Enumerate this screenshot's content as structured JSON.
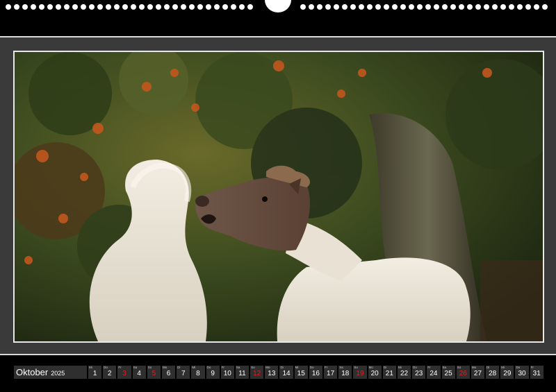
{
  "photo": {
    "subject": "two-ponies-photo"
  },
  "calendar": {
    "month": "Oktober",
    "year": "2025",
    "days": [
      {
        "wd": "Mi",
        "n": "1",
        "red": false
      },
      {
        "wd": "Do",
        "n": "2",
        "red": false
      },
      {
        "wd": "Fr",
        "n": "3",
        "red": true
      },
      {
        "wd": "Sa",
        "n": "4",
        "red": false
      },
      {
        "wd": "So",
        "n": "5",
        "red": true
      },
      {
        "wd": "Mo",
        "n": "6",
        "red": false
      },
      {
        "wd": "Di",
        "n": "7",
        "red": false
      },
      {
        "wd": "Mi",
        "n": "8",
        "red": false
      },
      {
        "wd": "Do",
        "n": "9",
        "red": false
      },
      {
        "wd": "Fr",
        "n": "10",
        "red": false
      },
      {
        "wd": "Sa",
        "n": "11",
        "red": false
      },
      {
        "wd": "So",
        "n": "12",
        "red": true
      },
      {
        "wd": "Mo",
        "n": "13",
        "red": false
      },
      {
        "wd": "Di",
        "n": "14",
        "red": false
      },
      {
        "wd": "Mi",
        "n": "15",
        "red": false
      },
      {
        "wd": "Do",
        "n": "16",
        "red": false
      },
      {
        "wd": "Fr",
        "n": "17",
        "red": false
      },
      {
        "wd": "Sa",
        "n": "18",
        "red": false
      },
      {
        "wd": "So",
        "n": "19",
        "red": true
      },
      {
        "wd": "Mo",
        "n": "20",
        "red": false
      },
      {
        "wd": "Di",
        "n": "21",
        "red": false
      },
      {
        "wd": "Mi",
        "n": "22",
        "red": false
      },
      {
        "wd": "Do",
        "n": "23",
        "red": false
      },
      {
        "wd": "Fr",
        "n": "24",
        "red": false
      },
      {
        "wd": "Sa",
        "n": "25",
        "red": false
      },
      {
        "wd": "So",
        "n": "26",
        "red": true
      },
      {
        "wd": "Mo",
        "n": "27",
        "red": false
      },
      {
        "wd": "Di",
        "n": "28",
        "red": false
      },
      {
        "wd": "Mi",
        "n": "29",
        "red": false
      },
      {
        "wd": "Do",
        "n": "30",
        "red": false
      },
      {
        "wd": "Fr",
        "n": "31",
        "red": false
      }
    ]
  },
  "colors": {
    "weekend_red": "#e02020",
    "cell_bg": "#2f2f2f",
    "sheet_bg": "#3a3a3a"
  }
}
